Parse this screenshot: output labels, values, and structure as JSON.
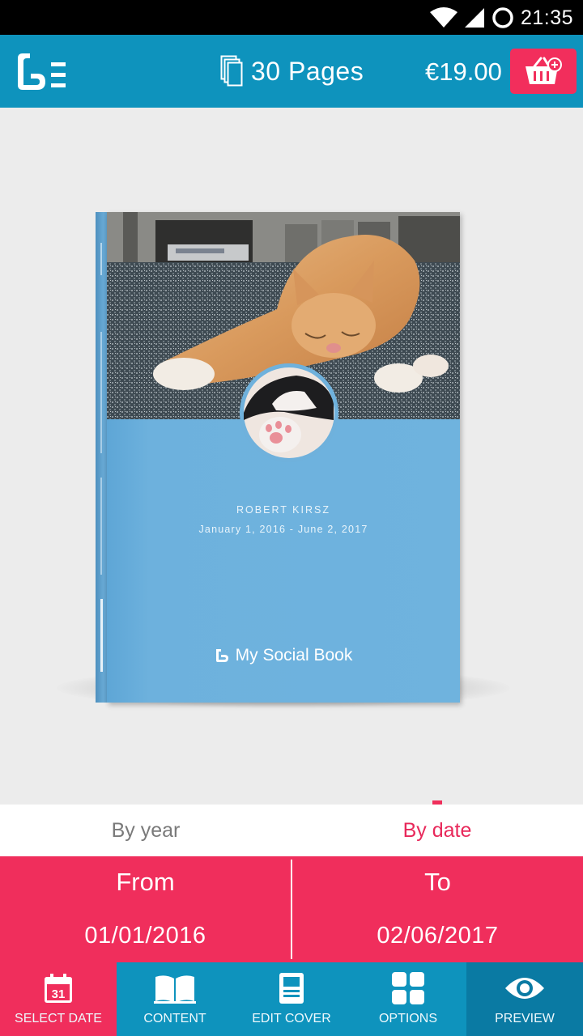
{
  "status_bar": {
    "time": "21:35"
  },
  "header": {
    "pages_label": "30 Pages",
    "price": "€19.00"
  },
  "book": {
    "author": "ROBERT KIRSZ",
    "date_range": "January 1, 2016 - June 2, 2017",
    "brand": "My Social Book"
  },
  "tabs": [
    {
      "label": "By year"
    },
    {
      "label": "By date"
    }
  ],
  "range": {
    "from_label": "From",
    "from_value": "01/01/2016",
    "to_label": "To",
    "to_value": "02/06/2017"
  },
  "nav": [
    {
      "label": "SELECT DATE",
      "icon": "calendar-icon",
      "calendar_day": "31"
    },
    {
      "label": "CONTENT",
      "icon": "book-icon"
    },
    {
      "label": "EDIT COVER",
      "icon": "cover-icon"
    },
    {
      "label": "OPTIONS",
      "icon": "grid-icon"
    },
    {
      "label": "PREVIEW",
      "icon": "eye-icon"
    }
  ],
  "colors": {
    "primary": "#0e93bd",
    "accent": "#f02e5c",
    "cover_blue": "#6fb1dc"
  }
}
